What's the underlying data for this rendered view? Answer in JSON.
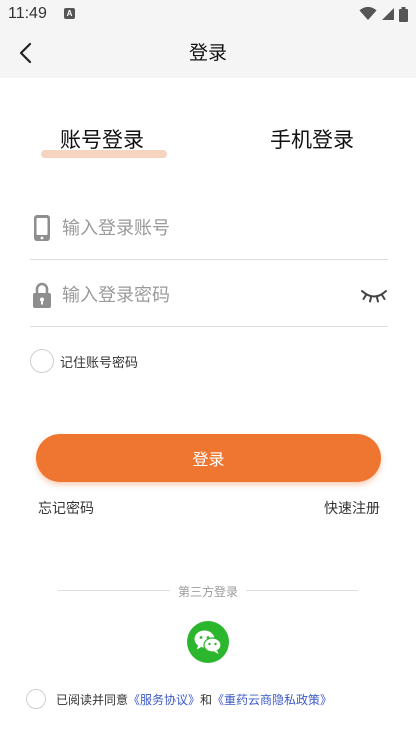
{
  "status_bar": {
    "time": "11:49",
    "a_icon": "A"
  },
  "nav": {
    "title": "登录",
    "back_icon": "chevron-left-icon"
  },
  "tabs": [
    {
      "label": "账号登录",
      "active": true
    },
    {
      "label": "手机登录",
      "active": false
    }
  ],
  "account_field": {
    "placeholder": "输入登录账号",
    "value": "",
    "icon": "phone-icon"
  },
  "password_field": {
    "placeholder": "输入登录密码",
    "value": "",
    "icon": "lock-icon",
    "toggle_icon": "eye-closed-icon"
  },
  "remember": {
    "label": "记住账号密码",
    "checked": false
  },
  "login_button": {
    "label": "登录"
  },
  "links": {
    "forgot": "忘记密码",
    "register": "快速注册"
  },
  "third_party": {
    "label": "第三方登录",
    "icon": "wechat-icon"
  },
  "agreement": {
    "prefix": "已阅读并同意",
    "service_link": "《服务协议》",
    "conjunction": "和",
    "privacy_link": "《重药云商隐私政策》",
    "checked": false
  },
  "colors": {
    "accent": "#ee7630",
    "tab_underline": "#f7d4c0",
    "link": "#3c59c9",
    "wechat": "#2bb62e"
  }
}
